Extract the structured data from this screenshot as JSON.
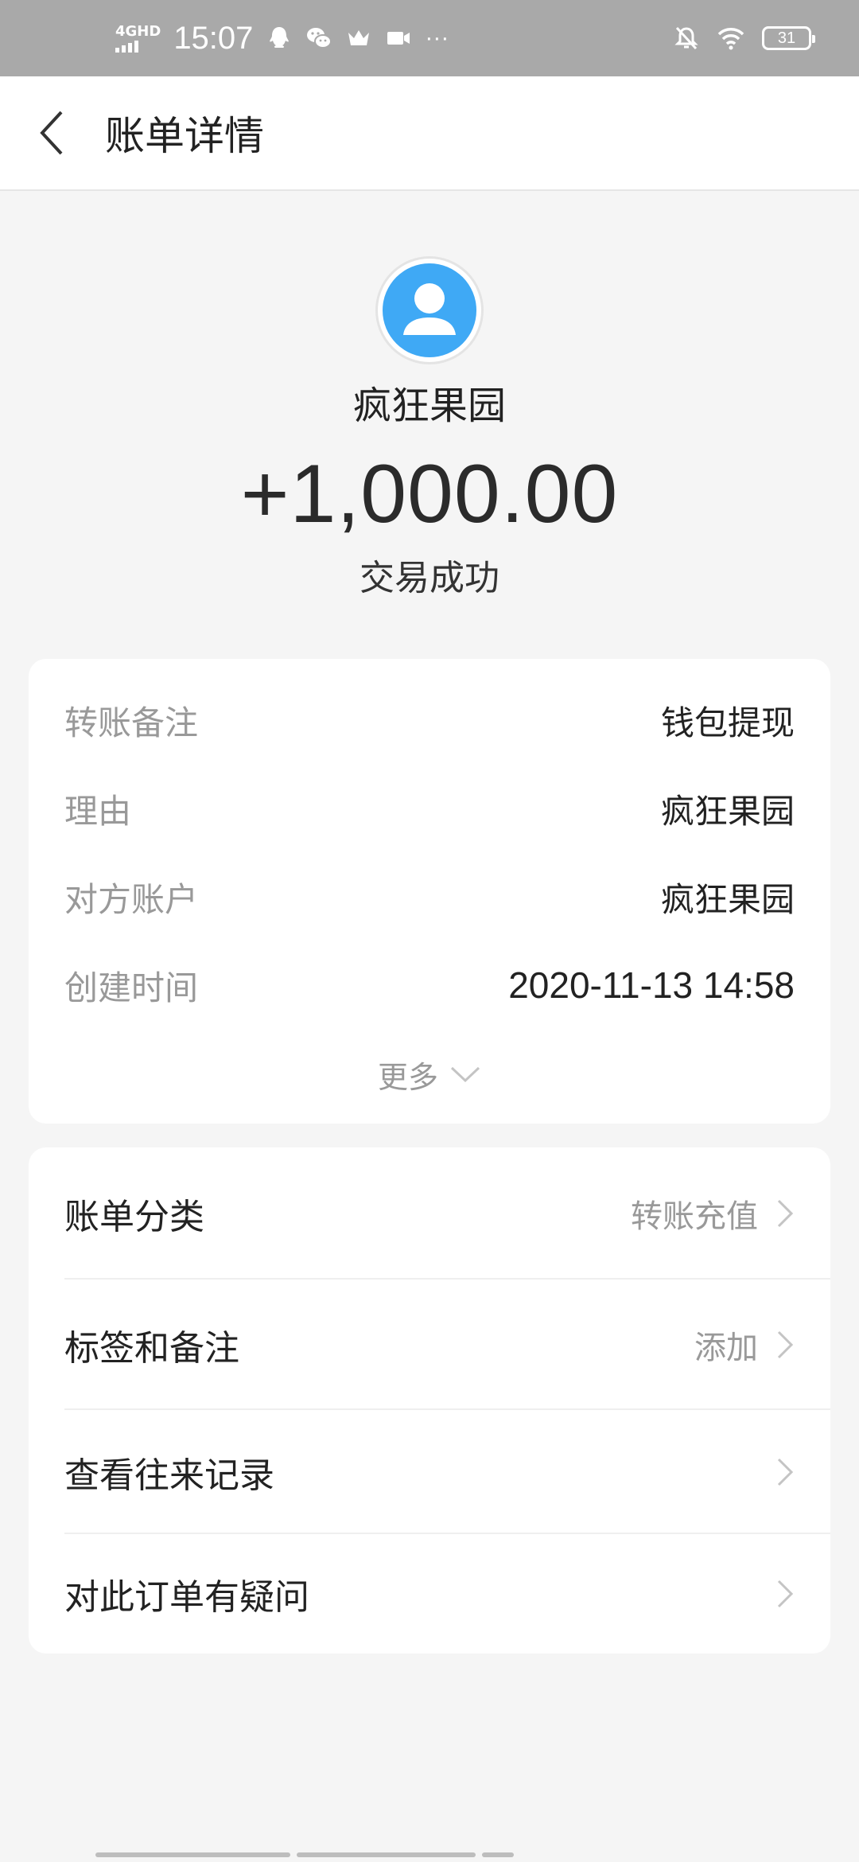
{
  "status_bar": {
    "network": "4GHD",
    "time": "15:07",
    "battery": "31",
    "more": "···",
    "icons": [
      "qq-icon",
      "wechat-icon",
      "crown-icon",
      "video-icon",
      "mute-bell-icon",
      "wifi-icon",
      "battery-icon"
    ]
  },
  "header": {
    "title": "账单详情",
    "back_icon": "chevron-left-icon"
  },
  "summary": {
    "payee": "疯狂果园",
    "amount": "+1,000.00",
    "status": "交易成功",
    "avatar_color": "#3fa9f5"
  },
  "details": {
    "rows": [
      {
        "label": "转账备注",
        "value": "钱包提现"
      },
      {
        "label": "理由",
        "value": "疯狂果园"
      },
      {
        "label": "对方账户",
        "value": "疯狂果园"
      },
      {
        "label": "创建时间",
        "value": "2020-11-13 14:58"
      }
    ],
    "more_label": "更多"
  },
  "actions": [
    {
      "label": "账单分类",
      "value": "转账充值"
    },
    {
      "label": "标签和备注",
      "value": "添加"
    },
    {
      "label": "查看往来记录",
      "value": ""
    },
    {
      "label": "对此订单有疑问",
      "value": ""
    }
  ]
}
